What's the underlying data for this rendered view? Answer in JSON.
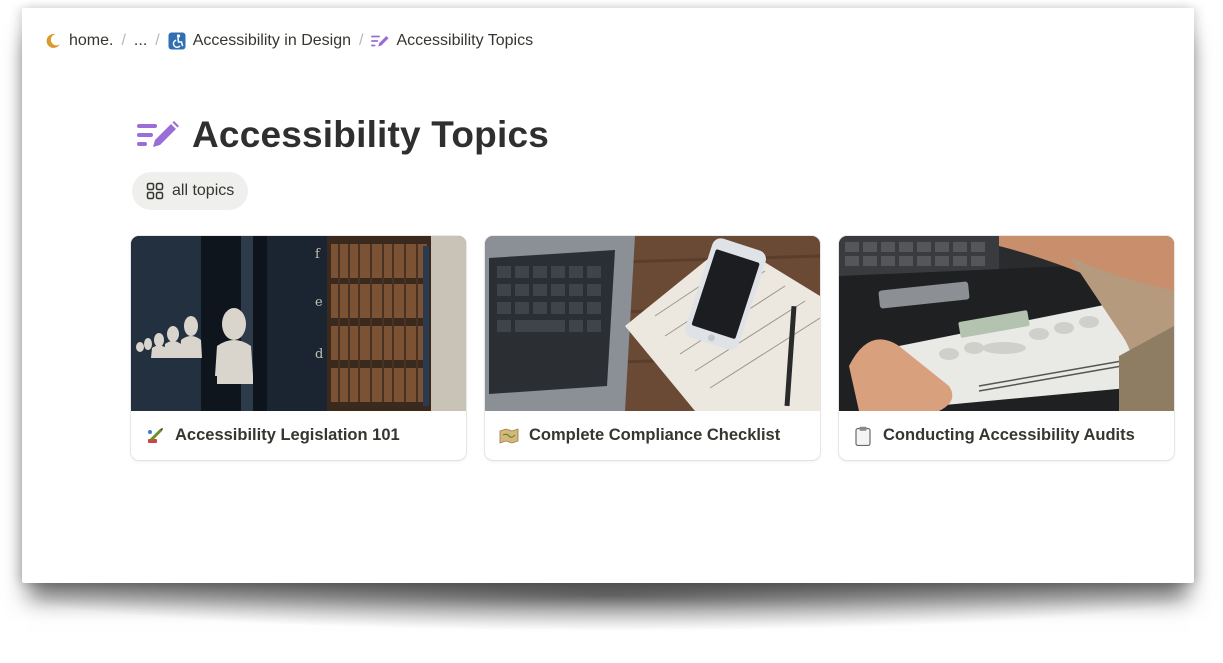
{
  "breadcrumb": {
    "items": [
      {
        "label": "home.",
        "icon": "crescent-moon-icon"
      },
      {
        "label": "..."
      },
      {
        "label": "Accessibility in Design",
        "icon": "accessibility-icon"
      },
      {
        "label": "Accessibility Topics",
        "icon": "edit-list-icon"
      }
    ],
    "separator": "/"
  },
  "page": {
    "title": "Accessibility Topics",
    "title_icon": "edit-list-icon"
  },
  "view": {
    "tab_label": "all topics",
    "tab_icon": "gallery-grid-icon"
  },
  "cards": [
    {
      "title": "Accessibility Legislation 101",
      "emoji": "scales-pen-icon",
      "cover": "library-busts-photo"
    },
    {
      "title": "Complete Compliance Checklist",
      "emoji": "map-scroll-icon",
      "cover": "laptop-phone-desk-photo"
    },
    {
      "title": "Conducting Accessibility Audits",
      "emoji": "clipboard-icon",
      "cover": "braille-display-photo"
    }
  ],
  "colors": {
    "accent_purple": "#9a6dd7",
    "moon_gold": "#d99b2b",
    "accessibility_blue": "#2f6fb2",
    "text": "#37352f",
    "tab_bg": "#efefed"
  }
}
